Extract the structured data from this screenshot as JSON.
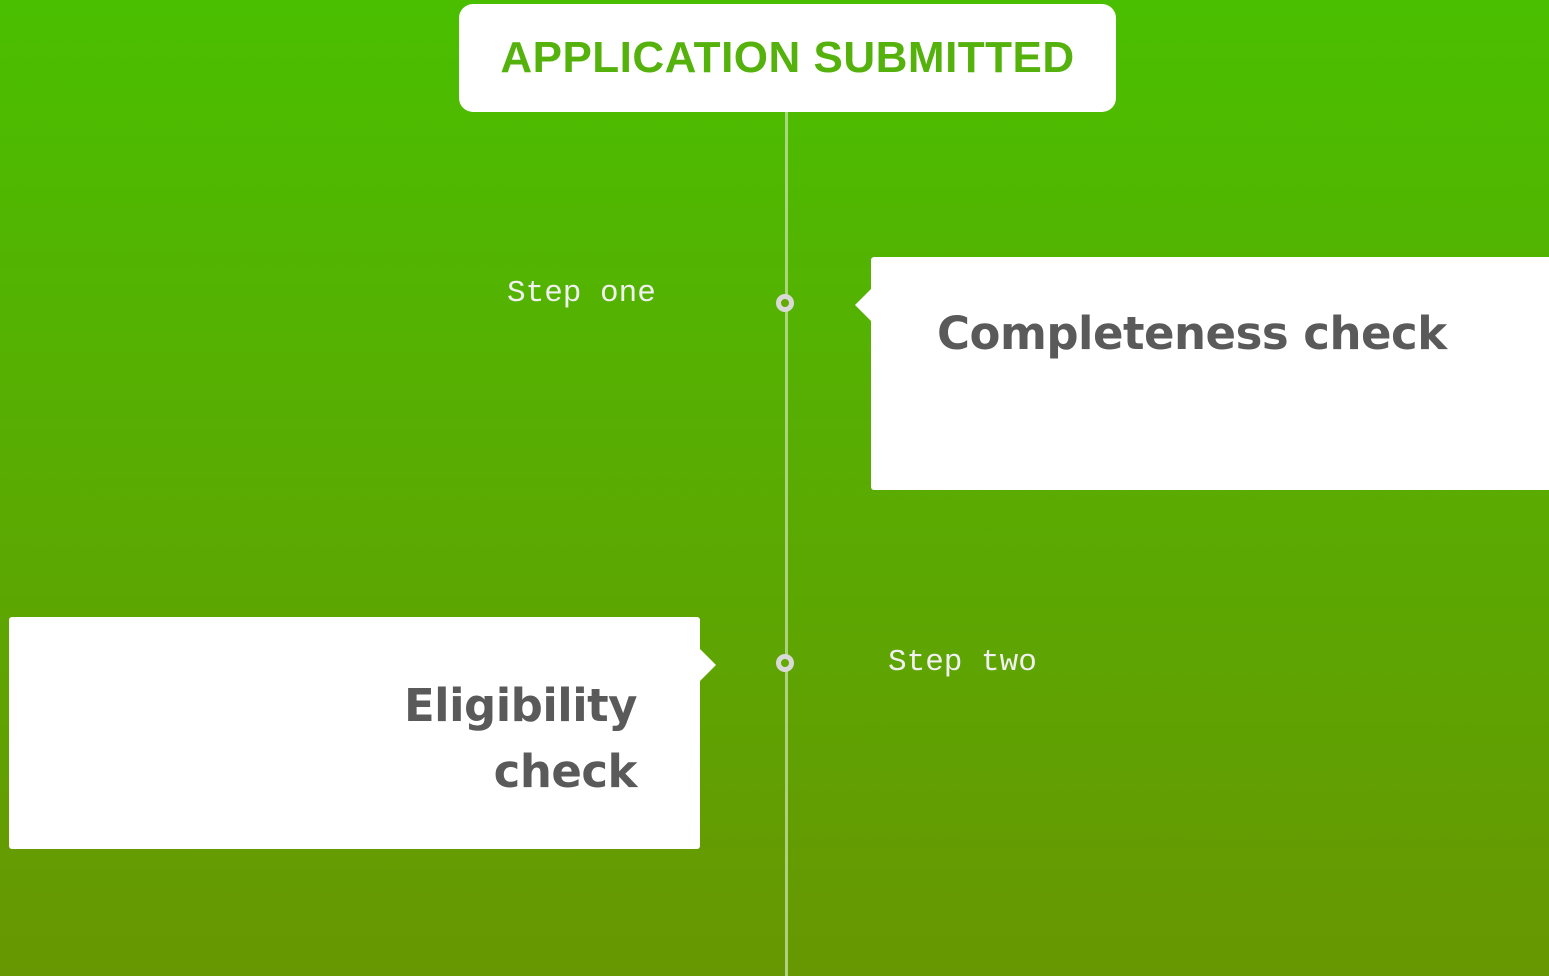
{
  "header": {
    "title": "APPLICATION SUBMITTED"
  },
  "steps": [
    {
      "label": "Step one",
      "title": "Completeness check"
    },
    {
      "label": "Step two",
      "title": "Eligibility check"
    }
  ],
  "colors": {
    "background_top": "#4abf00",
    "background_bottom": "#679702",
    "header_text": "#55b20c",
    "card_text": "#5a5a5a",
    "step_text": "#f0f0f0"
  }
}
